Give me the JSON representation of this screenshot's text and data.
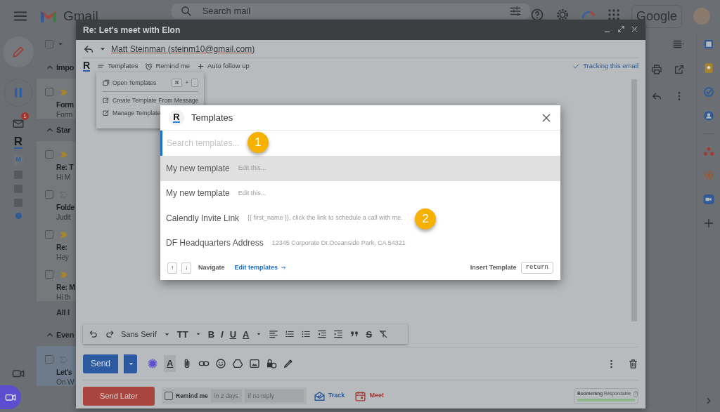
{
  "topbar": {
    "app_name": "Gmail",
    "search_placeholder": "Search mail",
    "account_brand": "Google"
  },
  "rail": {
    "unread_badge": "1",
    "logo": "R",
    "app_label": "M"
  },
  "list_toolbar": {
    "select_all_checked": false
  },
  "mail_list": [
    {
      "kind": "section",
      "label": "Impo",
      "expanded": true
    },
    {
      "kind": "email",
      "subject": "Form",
      "snippet": "Form",
      "important": true,
      "selected": false
    },
    {
      "kind": "section",
      "label": "Star",
      "expanded": true
    },
    {
      "kind": "email",
      "subject": "Re: T",
      "snippet": "Hi M",
      "important": true,
      "selected": false
    },
    {
      "kind": "email",
      "subject": "Folde",
      "snippet": "Judit",
      "important": false,
      "selected": false
    },
    {
      "kind": "email",
      "subject": "Re:",
      "snippet": "Hey",
      "important": true,
      "selected": false
    },
    {
      "kind": "email",
      "subject": "Re: M",
      "snippet": "Hi th",
      "important": true,
      "selected": false
    },
    {
      "kind": "section",
      "label": "All I"
    },
    {
      "kind": "section",
      "label": "Even",
      "expanded": true
    },
    {
      "kind": "email",
      "subject": "Let's",
      "snippet": "On W",
      "important": false,
      "selected": true
    }
  ],
  "compose": {
    "title": "Re: Let's meet with Elon",
    "from": "Matt Steinman (steinm10@gmail.com)",
    "addon_bar": {
      "logo": "R",
      "items": [
        "Templates",
        "Remind me",
        "Auto follow up"
      ],
      "tracking": "Tracking this email"
    },
    "format_toolbar": {
      "font": "Sans Serif",
      "text_size": "TT",
      "bold": "B",
      "italic": "I",
      "underline": "U",
      "text_color": "A",
      "strike": "S"
    },
    "send": "Send",
    "format_toggle": "A",
    "send_later": "Send Later",
    "remind": {
      "label": "Remind me",
      "checked": false,
      "delay": "in 2 days",
      "condition": "if no reply"
    },
    "track": "Track",
    "meet": "Meet",
    "respondable": {
      "brand": "Boomerang",
      "label": "Respondable",
      "help": "?",
      "level": 1
    }
  },
  "templates_menu": {
    "items": [
      {
        "label": "Open Templates",
        "shortcut": [
          "⌘",
          "+",
          ";"
        ]
      },
      {
        "label": "Create Template From Message"
      },
      {
        "label": "Manage Template"
      }
    ]
  },
  "templates_modal": {
    "logo": "R",
    "title": "Templates",
    "search_placeholder": "Search templates...",
    "rows": [
      {
        "name": "My new template",
        "preview": "Edit this...",
        "selected": true
      },
      {
        "name": "My new template",
        "preview": "Edit this...",
        "selected": false
      },
      {
        "name": "Calendly Invite Link",
        "preview": "{{ first_name }}, click the link to schedule a call with me.",
        "selected": false
      },
      {
        "name": "DF Headquarters Address",
        "preview": "12345 Corporate Dr.Oceanside Park, CA 54321",
        "selected": false
      }
    ],
    "footer": {
      "keys": [
        "↑",
        "↓"
      ],
      "navigate": "Navigate",
      "edit_link": "Edit templates",
      "insert": "Insert Template",
      "insert_key": "return"
    }
  },
  "callouts": [
    {
      "number": "1"
    },
    {
      "number": "2"
    }
  ]
}
